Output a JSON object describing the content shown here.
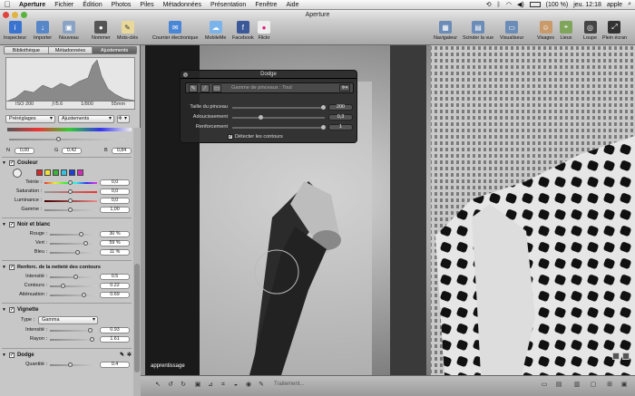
{
  "menubar": {
    "app": "Aperture",
    "items": [
      "Fichier",
      "Édition",
      "Photos",
      "Piles",
      "Métadonnées",
      "Présentation",
      "Fenêtre",
      "Aide"
    ],
    "battery": "(100 %)",
    "clock": "jeu. 12:18",
    "user": "apple"
  },
  "window": {
    "title": "Aperture"
  },
  "toolbar": {
    "left": [
      "Inspecteur",
      "Importer",
      "Nouveau",
      "Nommer",
      "Mots-clés"
    ],
    "center": [
      "Courrier électronique",
      "MobileMe",
      "Facebook",
      "Flickr"
    ],
    "right": [
      "Navigateur",
      "Scinder la vue",
      "Visualiseur",
      "Visages",
      "Lieux",
      "Loupe",
      "Plein écran"
    ]
  },
  "inspector": {
    "tabs": [
      "Bibliothèque",
      "Métadonnées",
      "Ajustements"
    ],
    "exif": [
      "ISO 200",
      "ƒ/5.6",
      "1/800",
      "55mm"
    ],
    "presets_label": "Préréglages",
    "adjustments_label": "Ajustements",
    "nvals": {
      "n_label": "N",
      "n": "0,00",
      "g_label": "G",
      "g": "0,42",
      "b_label": "B",
      "b": "0,84"
    },
    "couleur": {
      "title": "Couleur",
      "rows": [
        {
          "label": "Teinte :",
          "value": "0,0"
        },
        {
          "label": "Saturation :",
          "value": "0,0"
        },
        {
          "label": "Luminance :",
          "value": "0,0"
        },
        {
          "label": "Gamme :",
          "value": "1,00"
        }
      ]
    },
    "nb": {
      "title": "Noir et blanc",
      "rows": [
        {
          "label": "Rouge :",
          "value": "30 %"
        },
        {
          "label": "Vert :",
          "value": "59 %"
        },
        {
          "label": "Bleu :",
          "value": "11 %"
        }
      ]
    },
    "nettete": {
      "title": "Renforc. de la netteté des contours",
      "rows": [
        {
          "label": "Intensité :",
          "value": "0.5"
        },
        {
          "label": "Contours :",
          "value": "0.22"
        },
        {
          "label": "Atténuation :",
          "value": "0.69"
        }
      ]
    },
    "vignette": {
      "title": "Vignette",
      "type_label": "Type :",
      "type_value": "Gamma",
      "rows": [
        {
          "label": "Intensité :",
          "value": "0.93"
        },
        {
          "label": "Rayon :",
          "value": "1.61"
        }
      ]
    },
    "dodge": {
      "title": "Dodge",
      "rows": [
        {
          "label": "Quantité :",
          "value": "0.4"
        }
      ]
    }
  },
  "hud": {
    "title": "Dodge",
    "brush_range": "Gamme de pinceaux : Tout",
    "rows": [
      {
        "label": "Taille du pinceau",
        "value": "200"
      },
      {
        "label": "Adoucissement",
        "value": "0,3"
      },
      {
        "label": "Renforcement",
        "value": "1"
      }
    ],
    "detect": "Détecter les contours"
  },
  "viewer": {
    "watermark": "apprentissage"
  },
  "bottombar": {
    "status": "Traitement..."
  },
  "colors": {
    "accent": "#3d7ee0",
    "swatches": [
      "#d62828",
      "#f0e23a",
      "#3bb33b",
      "#35c3e0",
      "#1d3fd6",
      "#d42ab8"
    ]
  }
}
